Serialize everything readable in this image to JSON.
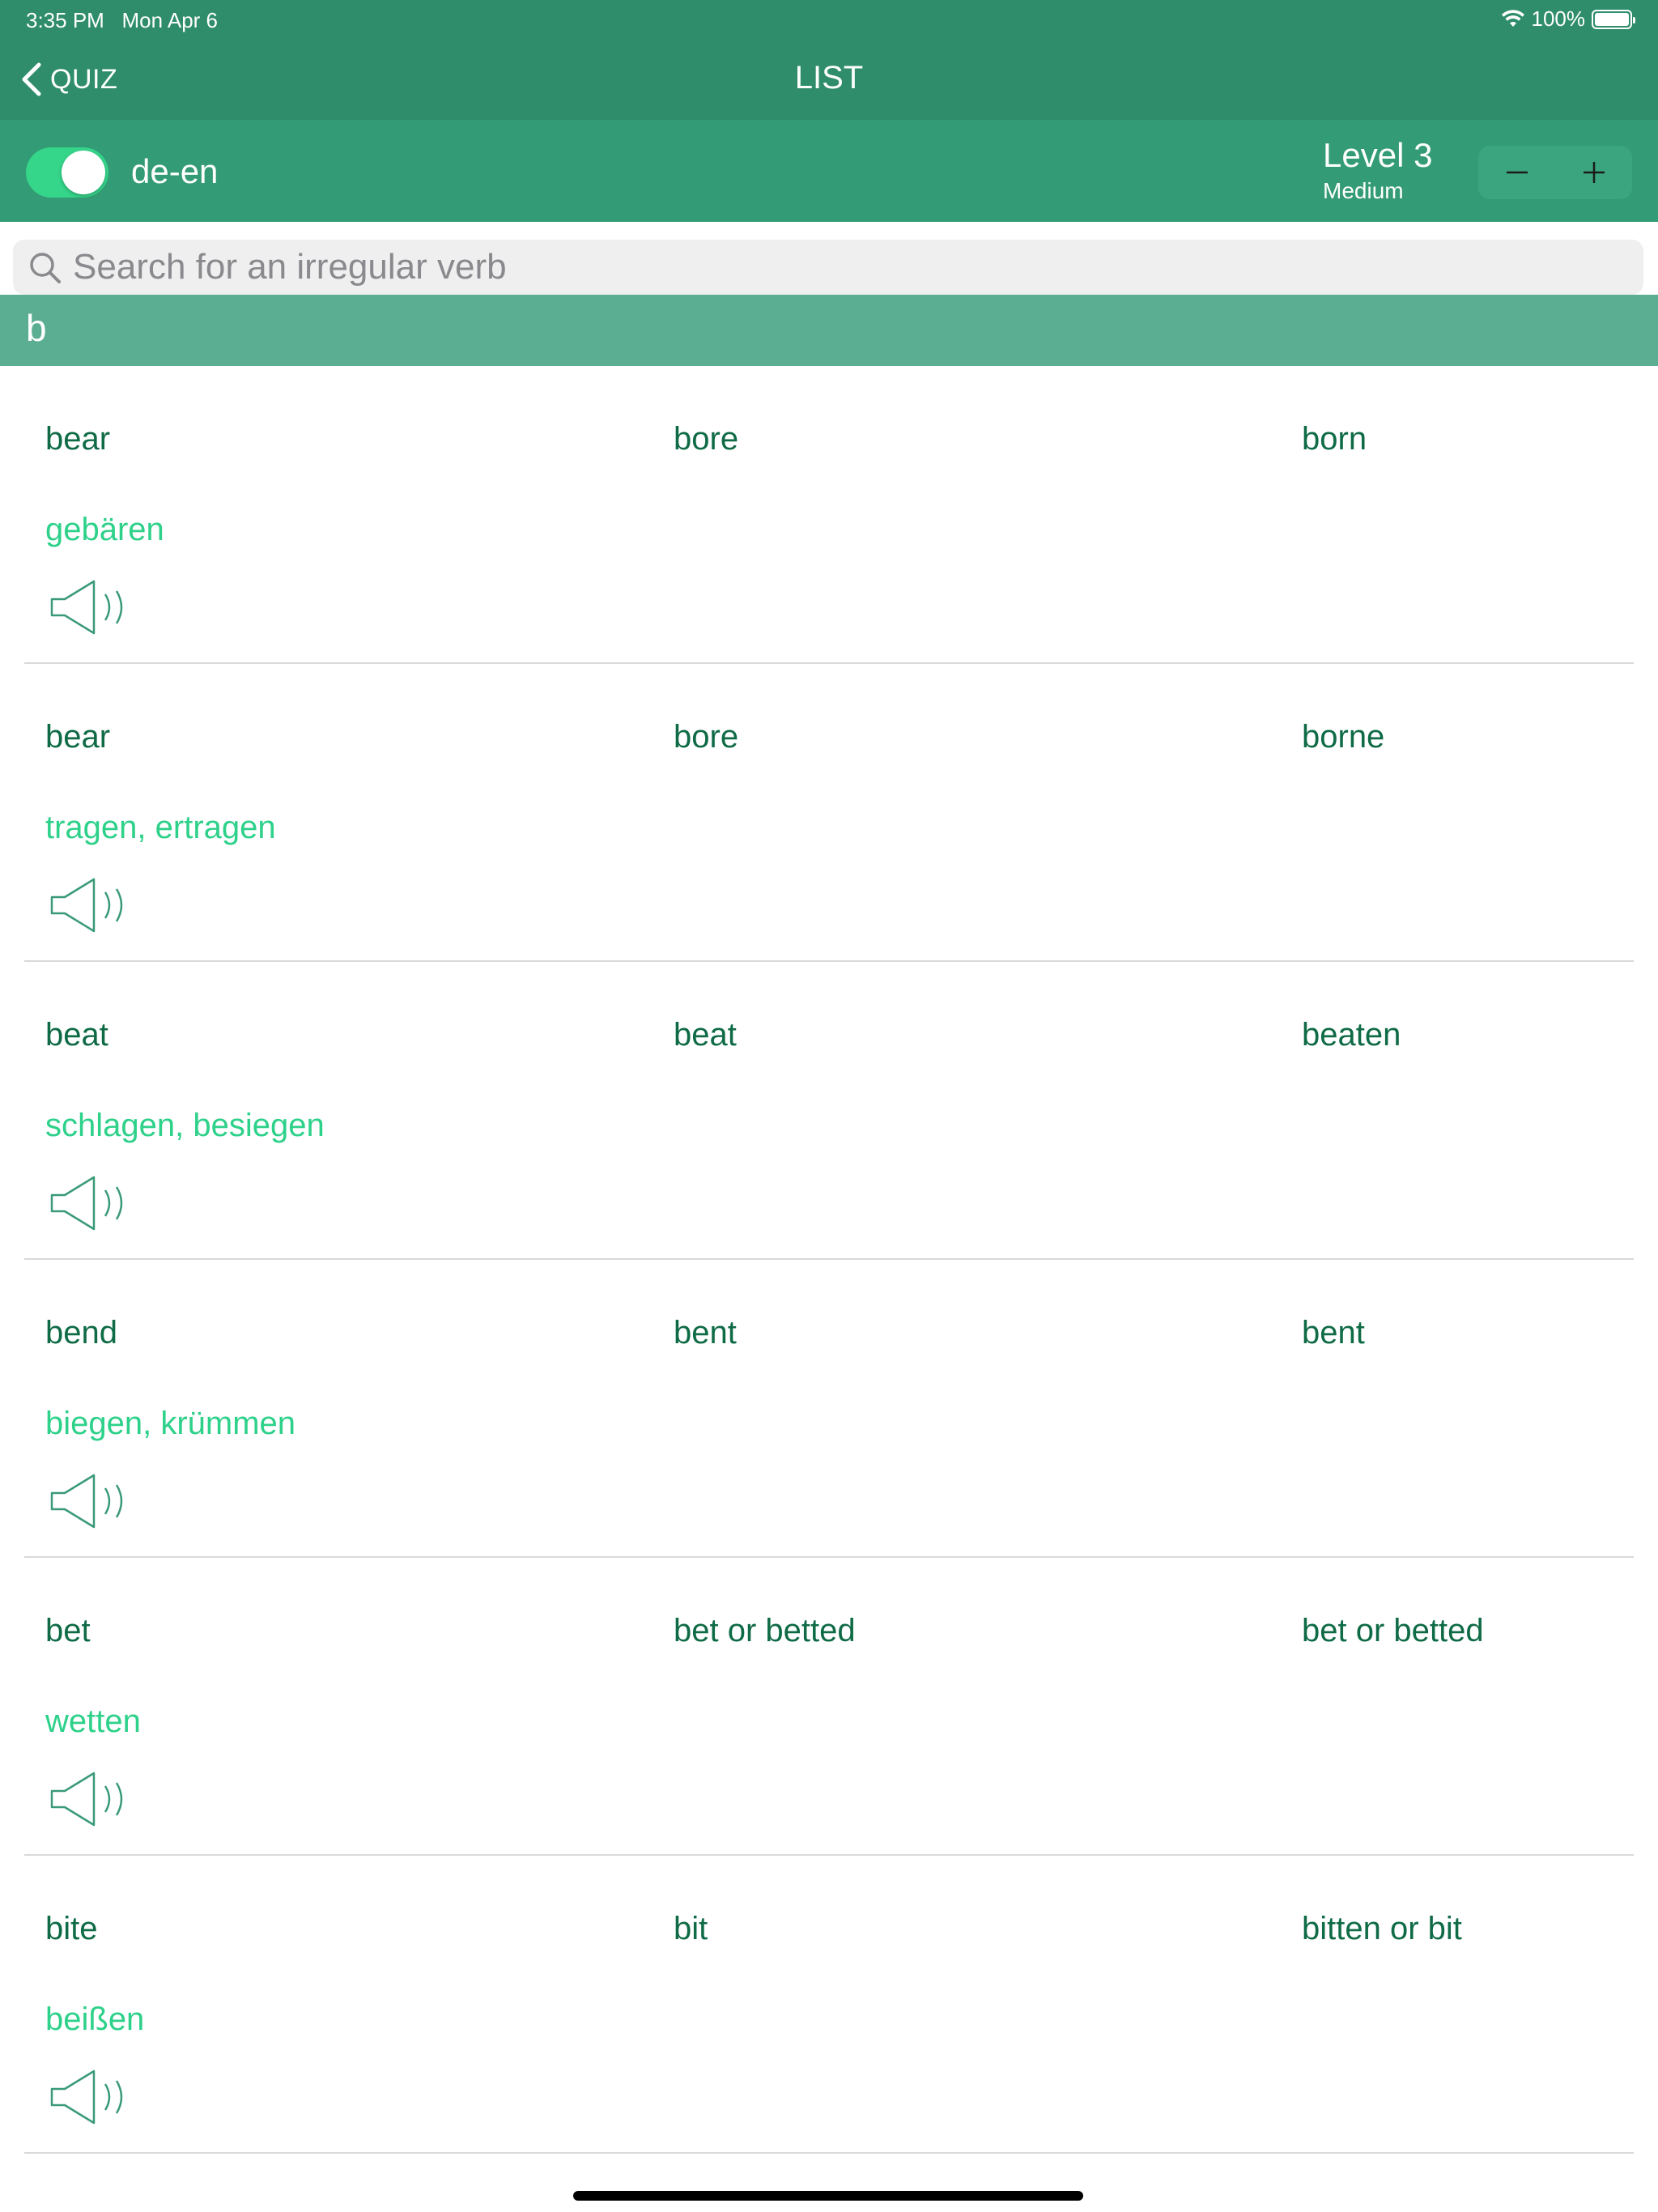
{
  "status_bar": {
    "time": "3:35 PM",
    "date": "Mon Apr 6",
    "battery": "100%",
    "wifi_icon": "wifi-icon",
    "battery_icon": "battery-icon"
  },
  "nav": {
    "back_label": "QUIZ",
    "title": "LIST"
  },
  "settings": {
    "direction_label": "de-en",
    "toggle_on": true,
    "level_title": "Level 3",
    "level_subtitle": "Medium"
  },
  "search": {
    "placeholder": "Search for an irregular verb",
    "value": ""
  },
  "section_header": "b",
  "verbs": [
    {
      "base": "bear",
      "past": "bore",
      "participle": "born",
      "translation": "gebären"
    },
    {
      "base": "bear",
      "past": "bore",
      "participle": "borne",
      "translation": "tragen, ertragen"
    },
    {
      "base": "beat",
      "past": "beat",
      "participle": "beaten",
      "translation": "schlagen, besiegen"
    },
    {
      "base": "bend",
      "past": "bent",
      "participle": "bent",
      "translation": "biegen, krümmen"
    },
    {
      "base": "bet",
      "past": "bet or betted",
      "participle": "bet or betted",
      "translation": "wetten"
    },
    {
      "base": "bite",
      "past": "bit",
      "participle": "bitten or bit",
      "translation": "beißen"
    }
  ],
  "colors": {
    "nav_bg": "#2f8d6c",
    "settings_bg": "#339b75",
    "section_bg": "#5cae93",
    "toggle_on": "#35d58a",
    "verb_text": "#0f6b46",
    "translation_text": "#2ed18a",
    "speaker_stroke": "#3a9a78"
  }
}
